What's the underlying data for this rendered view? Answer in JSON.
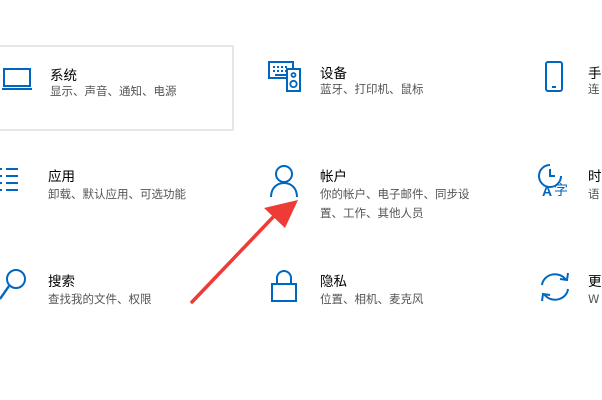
{
  "accent_color": "#0067c0",
  "annotation_color": "#ee3b35",
  "tiles": {
    "system": {
      "title": "系统",
      "desc": "显示、声音、通知、电源",
      "icon": "laptop-icon"
    },
    "devices": {
      "title": "设备",
      "desc": "蓝牙、打印机、鼠标",
      "icon": "keyboard-speaker-icon"
    },
    "phone": {
      "title": "手",
      "desc": "连",
      "icon": "phone-icon"
    },
    "apps": {
      "title": "应用",
      "desc": "卸载、默认应用、可选功能",
      "icon": "app-list-icon"
    },
    "accounts": {
      "title": "帐户",
      "desc_line1": "你的帐户、电子邮件、同步设",
      "desc_line2": "置、工作、其他人员",
      "icon": "person-icon"
    },
    "time": {
      "title": "时",
      "desc": "语",
      "icon": "time-language-icon"
    },
    "search": {
      "title": "搜索",
      "desc": "查找我的文件、权限",
      "icon": "search-icon"
    },
    "privacy": {
      "title": "隐私",
      "desc": "位置、相机、麦克风",
      "icon": "lock-icon"
    },
    "update": {
      "title": "更",
      "desc": "W",
      "icon": "sync-icon"
    }
  }
}
